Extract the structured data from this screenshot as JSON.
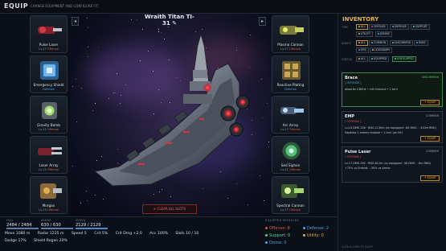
{
  "app": {
    "title": "EQUIP",
    "subtitle": "CHANGE EQUIPMENT AND CONFIGURE FIT"
  },
  "ship": {
    "name": "Wraith Titan TI-31",
    "edit_glyph": "✎",
    "prev_glyph": "◂",
    "next_glyph": "▸"
  },
  "slots_left": [
    {
      "name": "Pulse Laser",
      "level": "Lv.17",
      "category": "Offense",
      "kind": "off"
    },
    {
      "name": "Emergency Shield",
      "level": "",
      "category": "Defense",
      "kind": "def"
    },
    {
      "name": "Gravity Bomb",
      "level": "Lv.12",
      "category": "Offense",
      "kind": "off"
    },
    {
      "name": "Laser Array",
      "level": "Lv.15",
      "category": "Offense",
      "kind": "off"
    },
    {
      "name": "Morgan",
      "level": "Lv.15",
      "category": "Offense",
      "kind": "off"
    }
  ],
  "slots_right": [
    {
      "name": "Plasma Cannon",
      "level": "Lv.17",
      "category": "Offense",
      "kind": "off"
    },
    {
      "name": "Reactive Plating",
      "level": "",
      "category": "Defense",
      "kind": "def"
    },
    {
      "name": "Arc Array",
      "level": "Lv.17",
      "category": "Offense",
      "kind": "off"
    },
    {
      "name": "Sed Siphon",
      "level": "Lv.11",
      "category": "Offense",
      "kind": "off"
    },
    {
      "name": "Spectral Cannon",
      "level": "Lv.17",
      "category": "Offense",
      "kind": "off"
    }
  ],
  "clear_label": "✕ CLEAR ALL SLOTS",
  "bars": [
    {
      "label": "HULL",
      "value": "2484 / 2484",
      "fraction": 1.0,
      "color": "#5a7fa6"
    },
    {
      "label": "ARMOR",
      "value": "630 / 630",
      "fraction": 1.0,
      "color": "#5a7fa6"
    },
    {
      "label": "SHIELD",
      "value": "2129 / 2129",
      "fraction": 1.0,
      "color": "#3f8fd6"
    }
  ],
  "stats_row1": [
    "Move 1080 m",
    "Radar 1225 m",
    "Speed 5",
    "Crit 5%",
    "Crit Dmg +2.0",
    "Acc 100%",
    "Slots 10 / 10"
  ],
  "stats_row2": [
    "Dodge 17%",
    "Shield Regen 20%"
  ],
  "modules": {
    "header": "EQUIPPED MODULES",
    "items": [
      {
        "label": "Offense: 8",
        "color": "#e0554a"
      },
      {
        "label": "Defense: 2",
        "color": "#4aa3e8"
      },
      {
        "label": "Support: 0",
        "color": "#5bd68a"
      },
      {
        "label": "Utility: 0",
        "color": "#e0ae4e"
      },
      {
        "label": "Drone: 0",
        "color": "#4aa3e8"
      }
    ]
  },
  "inventory": {
    "title": "INVENTORY",
    "filters": [
      {
        "label": "TYPE",
        "chips": [
          {
            "text": "ALL",
            "on": true,
            "dot": "#e0ae4e"
          },
          {
            "text": "OFFENSE",
            "on": false,
            "dot": "#e0554a"
          },
          {
            "text": "DEFENSE",
            "on": false,
            "dot": "#4aa3e8"
          },
          {
            "text": "SUPPORT",
            "on": false,
            "dot": "#5bd68a"
          }
        ]
      },
      {
        "label": "",
        "chips": [
          {
            "text": "UTILITY",
            "on": false,
            "dot": "#e0ae4e"
          },
          {
            "text": "DRONE",
            "on": false,
            "dot": "#4aa3e8"
          }
        ]
      },
      {
        "label": "RARITY",
        "chips": [
          {
            "text": "ALL",
            "on": true,
            "dot": "#e0ae4e"
          },
          {
            "text": "COMMON",
            "on": false,
            "dot": "#9aa6b2"
          },
          {
            "text": "UNCOMMON",
            "on": false,
            "dot": "#5bd68a"
          },
          {
            "text": "RARE",
            "on": false,
            "dot": "#4aa3e8"
          }
        ]
      },
      {
        "label": "",
        "chips": [
          {
            "text": "EPIC",
            "on": false,
            "dot": "#a86be0"
          },
          {
            "text": "LEGENDARY",
            "on": false,
            "dot": "#e0ae4e"
          }
        ]
      },
      {
        "label": "STATUS",
        "chips": [
          {
            "text": "ALL",
            "on": false,
            "dot": "#e0ae4e"
          },
          {
            "text": "EQUIPPED",
            "on": false,
            "dot": "#5bd68a"
          },
          {
            "text": "UNEQUIPPED",
            "on": true,
            "dot": "#5bd68a",
            "green": true
          }
        ]
      }
    ],
    "cards": [
      {
        "name": "Brace",
        "rarity": "UNCOMMON",
        "tag": "[ DEFENSE ]",
        "tag_color": "#4aa3e8",
        "lines": [
          "Absorbs 136/hit • crit immune • 1 turn"
        ],
        "equip": "+ EQUIP",
        "selected": true
      },
      {
        "name": "EMP",
        "rarity": "COMMON",
        "tag": "[ OFFENSE ]",
        "tag_color": "#e0554a",
        "lines": [
          "Lv.14  DMG 226 · RNG 1130m  (vs equipped: -64 DMG · -310m RNG)",
          "Disables 1 enemy module • 1 turn (on hit)"
        ],
        "equip": "+ EQUIP",
        "selected": false
      },
      {
        "name": "Pulse Laser",
        "rarity": "COMMON",
        "tag": "[ OFFENSE ]",
        "tag_color": "#e0554a",
        "lines": [
          "Lv.17  DMG 292 · RNG 812m  (vs equipped: -58 DMG · -6m RNG)",
          "+75% vs Shields  ·  -50% vs Armor"
        ],
        "equip": "+ EQUIP",
        "selected": false
      }
    ],
    "footer": "CLICK A CARD TO EQUIP"
  }
}
